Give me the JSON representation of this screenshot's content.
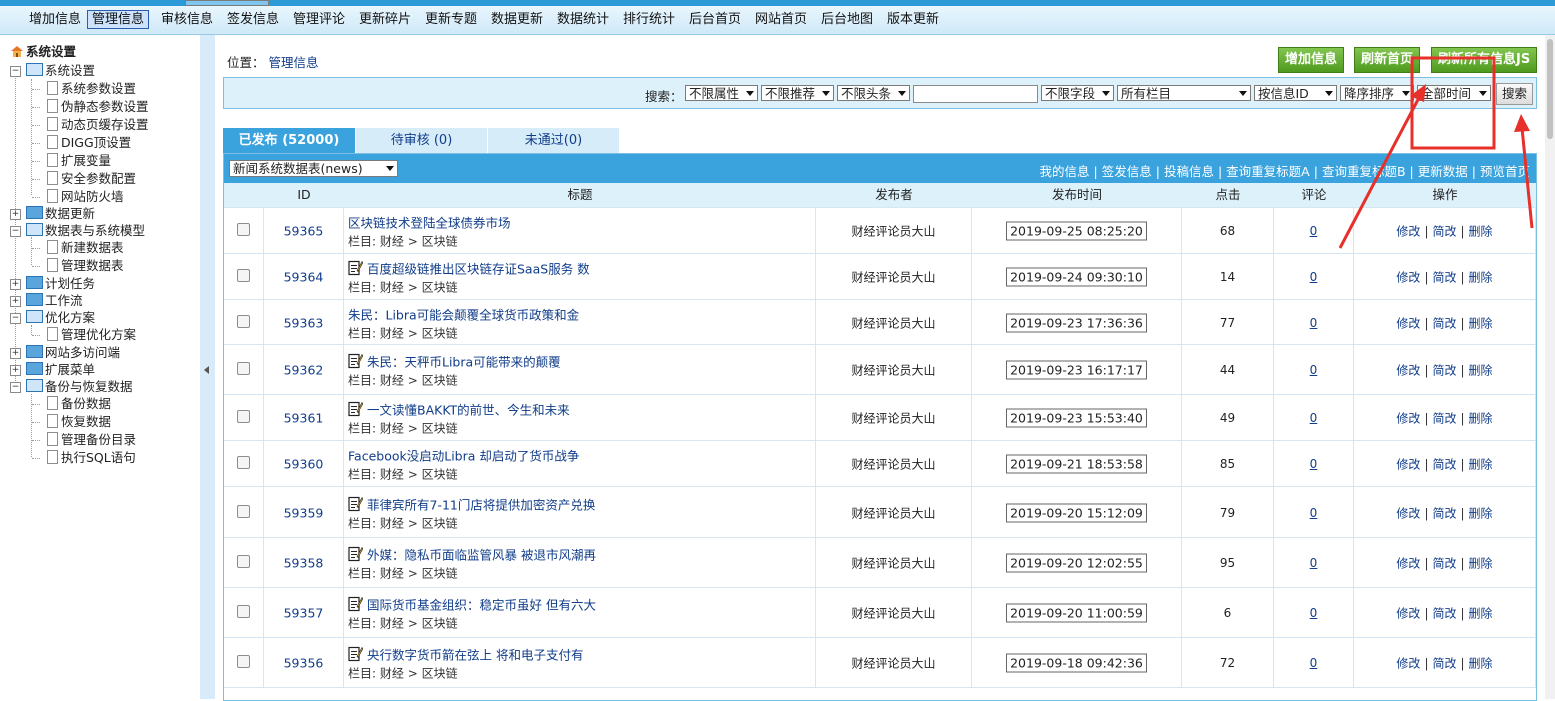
{
  "top_menu": [
    "增加信息",
    "管理信息",
    "审核信息",
    "签发信息",
    "管理评论",
    "更新碎片",
    "更新专题",
    "数据更新",
    "数据统计",
    "排行统计",
    "后台首页",
    "网站首页",
    "后台地图",
    "版本更新"
  ],
  "top_menu_active": "管理信息",
  "tree": {
    "root": "系统设置",
    "groups": [
      {
        "label": "系统设置",
        "expanded": true,
        "children": [
          "系统参数设置",
          "伪静态参数设置",
          "动态页缓存设置",
          "DIGG顶设置",
          "扩展变量",
          "安全参数配置",
          "网站防火墙"
        ]
      },
      {
        "label": "数据更新",
        "expanded": false,
        "children": []
      },
      {
        "label": "数据表与系统模型",
        "expanded": true,
        "children": [
          "新建数据表",
          "管理数据表"
        ]
      },
      {
        "label": "计划任务",
        "expanded": false,
        "children": []
      },
      {
        "label": "工作流",
        "expanded": false,
        "children": []
      },
      {
        "label": "优化方案",
        "expanded": true,
        "children": [
          "管理优化方案"
        ]
      },
      {
        "label": "网站多访问端",
        "expanded": false,
        "children": []
      },
      {
        "label": "扩展菜单",
        "expanded": false,
        "children": []
      },
      {
        "label": "备份与恢复数据",
        "expanded": true,
        "children": [
          "备份数据",
          "恢复数据",
          "管理备份目录",
          "执行SQL语句"
        ]
      }
    ]
  },
  "location": {
    "label": "位置：",
    "link": "管理信息"
  },
  "actions": {
    "add": "增加信息",
    "refresh_home": "刷新首页",
    "refresh_js": "刷新所有信息JS"
  },
  "search": {
    "label": "搜索：",
    "attr": "不限属性",
    "recommend": "不限推荐",
    "headline": "不限头条",
    "keyword": "",
    "field": "不限字段",
    "column": "所有栏目",
    "by": "按信息ID",
    "order": "降序排序",
    "time": "全部时间",
    "button": "搜索"
  },
  "tabs": [
    {
      "label": "已发布 (52000)",
      "active": true
    },
    {
      "label": "待审核 (0)",
      "active": false
    },
    {
      "label": "未通过(0)",
      "active": false
    }
  ],
  "table_select": "新闻系统数据表(news)",
  "quick_links": [
    "我的信息",
    "签发信息",
    "投稿信息",
    "查询重复标题A",
    "查询重复标题B",
    "更新数据",
    "预览首页"
  ],
  "columns": {
    "id": "ID",
    "title": "标题",
    "author": "发布者",
    "time": "发布时间",
    "clicks": "点击",
    "comments": "评论",
    "ops": "操作"
  },
  "ops": {
    "edit": "修改",
    "simple_edit": "简改",
    "delete": "删除"
  },
  "category_prefix": "栏目:",
  "category": {
    "parent": "财经",
    "sep": ">",
    "child": "区块链"
  },
  "rows": [
    {
      "id": "59365",
      "title": "区块链技术登陆全球债券市场",
      "icon": false,
      "author": "财经评论员大山",
      "time": "2019-09-25 08:25:20",
      "clicks": "68",
      "comments": "0"
    },
    {
      "id": "59364",
      "title": "百度超级链推出区块链存证SaaS服务 数",
      "icon": true,
      "author": "财经评论员大山",
      "time": "2019-09-24 09:30:10",
      "clicks": "14",
      "comments": "0"
    },
    {
      "id": "59363",
      "title": "朱民：Libra可能会颠覆全球货币政策和金",
      "icon": false,
      "author": "财经评论员大山",
      "time": "2019-09-23 17:36:36",
      "clicks": "77",
      "comments": "0"
    },
    {
      "id": "59362",
      "title": "朱民：天秤币Libra可能带来的颠覆",
      "icon": true,
      "author": "财经评论员大山",
      "time": "2019-09-23 16:17:17",
      "clicks": "44",
      "comments": "0"
    },
    {
      "id": "59361",
      "title": "一文读懂BAKKT的前世、今生和未来",
      "icon": true,
      "author": "财经评论员大山",
      "time": "2019-09-23 15:53:40",
      "clicks": "49",
      "comments": "0"
    },
    {
      "id": "59360",
      "title": "Facebook没启动Libra 却启动了货币战争",
      "icon": false,
      "author": "财经评论员大山",
      "time": "2019-09-21 18:53:58",
      "clicks": "85",
      "comments": "0"
    },
    {
      "id": "59359",
      "title": "菲律宾所有7-11门店将提供加密资产兑换",
      "icon": true,
      "author": "财经评论员大山",
      "time": "2019-09-20 15:12:09",
      "clicks": "79",
      "comments": "0"
    },
    {
      "id": "59358",
      "title": "外媒：隐私币面临监管风暴 被退市风潮再",
      "icon": true,
      "author": "财经评论员大山",
      "time": "2019-09-20 12:02:55",
      "clicks": "95",
      "comments": "0"
    },
    {
      "id": "59357",
      "title": "国际货币基金组织：稳定币虽好 但有六大",
      "icon": true,
      "author": "财经评论员大山",
      "time": "2019-09-20 11:00:59",
      "clicks": "6",
      "comments": "0"
    },
    {
      "id": "59356",
      "title": "央行数字货币箭在弦上 将和电子支付有",
      "icon": true,
      "author": "财经评论员大山",
      "time": "2019-09-18 09:42:36",
      "clicks": "72",
      "comments": "0"
    }
  ],
  "colors": {
    "accent": "#3aa3de",
    "button_green": "#5aa62a",
    "annotation_red": "#e8302a"
  }
}
